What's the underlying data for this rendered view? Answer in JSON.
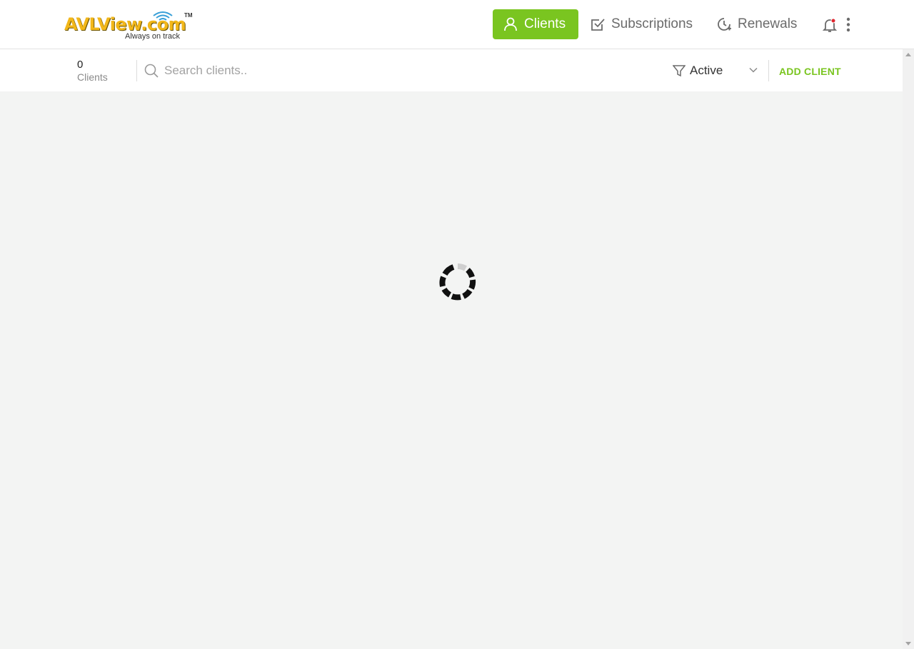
{
  "logo": {
    "brand": "AVLView.com",
    "tm": "TM",
    "tagline": "Always on track"
  },
  "nav": {
    "clients": "Clients",
    "subscriptions": "Subscriptions",
    "renewals": "Renewals"
  },
  "toolbar": {
    "count": "0",
    "count_label": "Clients",
    "search_placeholder": "Search clients..",
    "search_value": "",
    "filter_value": "Active",
    "add_client": "ADD CLIENT"
  },
  "colors": {
    "accent": "#7ac520",
    "notification_dot": "#e0262e",
    "background": "#f3f4f3"
  },
  "icons": [
    "user-icon",
    "checkbox-icon",
    "renewal-icon",
    "bell-icon",
    "kebab-icon",
    "search-icon",
    "filter-icon",
    "chevron-down-icon",
    "loading-spinner"
  ]
}
